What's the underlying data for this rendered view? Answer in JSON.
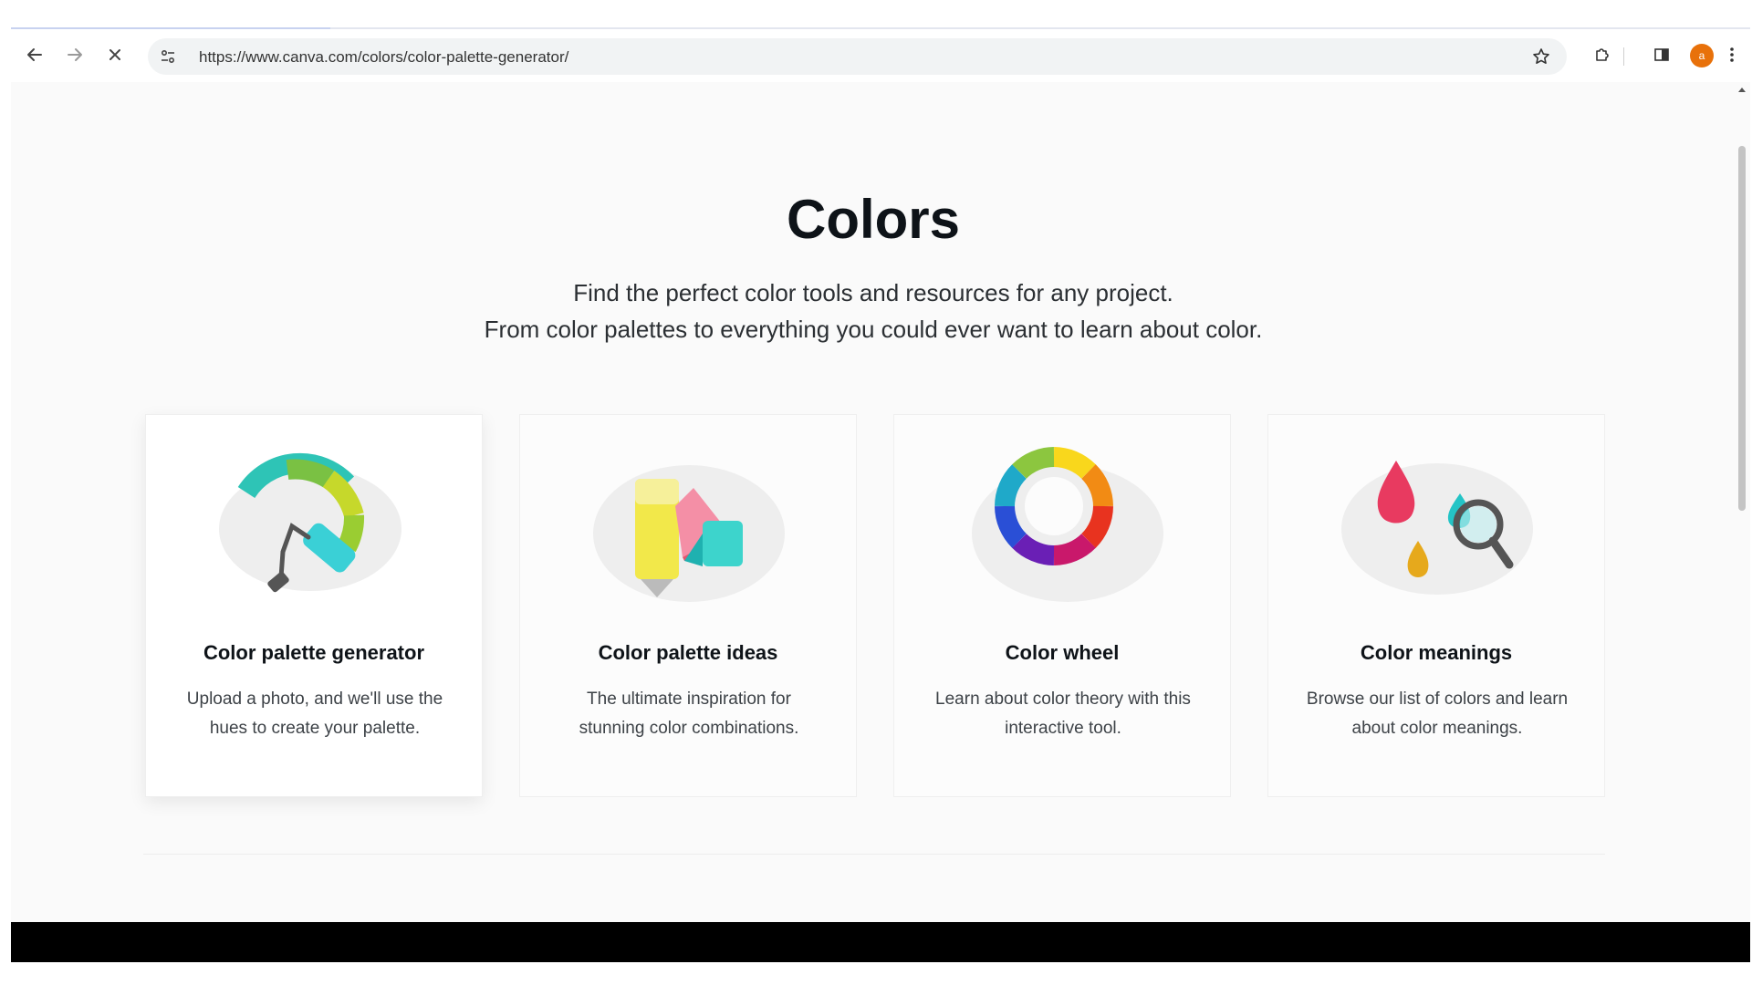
{
  "browser": {
    "url": "https://www.canva.com/colors/color-palette-generator/",
    "profile_initial": "a",
    "icons": {
      "back": "arrow-left-icon",
      "forward": "arrow-right-icon",
      "stop": "close-icon",
      "site_settings": "tune-icon",
      "bookmark": "star-icon",
      "extensions": "puzzle-icon",
      "side_panel": "side-panel-icon",
      "menu": "more-vert-icon"
    }
  },
  "page": {
    "title": "Colors",
    "subtitle_line1": "Find the perfect color tools and resources for any project.",
    "subtitle_line2": "From color palettes to everything you could ever want to learn about color."
  },
  "cards": [
    {
      "title": "Color palette generator",
      "description": "Upload a photo, and we'll use the hues to create your palette.",
      "icon": "paint-roller-icon"
    },
    {
      "title": "Color palette ideas",
      "description": "The ultimate inspiration for stunning color combinations.",
      "icon": "swatch-fan-icon"
    },
    {
      "title": "Color wheel",
      "description": "Learn about color theory with this interactive tool.",
      "icon": "color-wheel-icon"
    },
    {
      "title": "Color meanings",
      "description": "Browse our list of colors and learn about color meanings.",
      "icon": "droplets-magnifier-icon"
    }
  ],
  "colors": {
    "title_text": "#0e1318",
    "body_text": "#3d4247",
    "avatar": "#e8710a"
  }
}
